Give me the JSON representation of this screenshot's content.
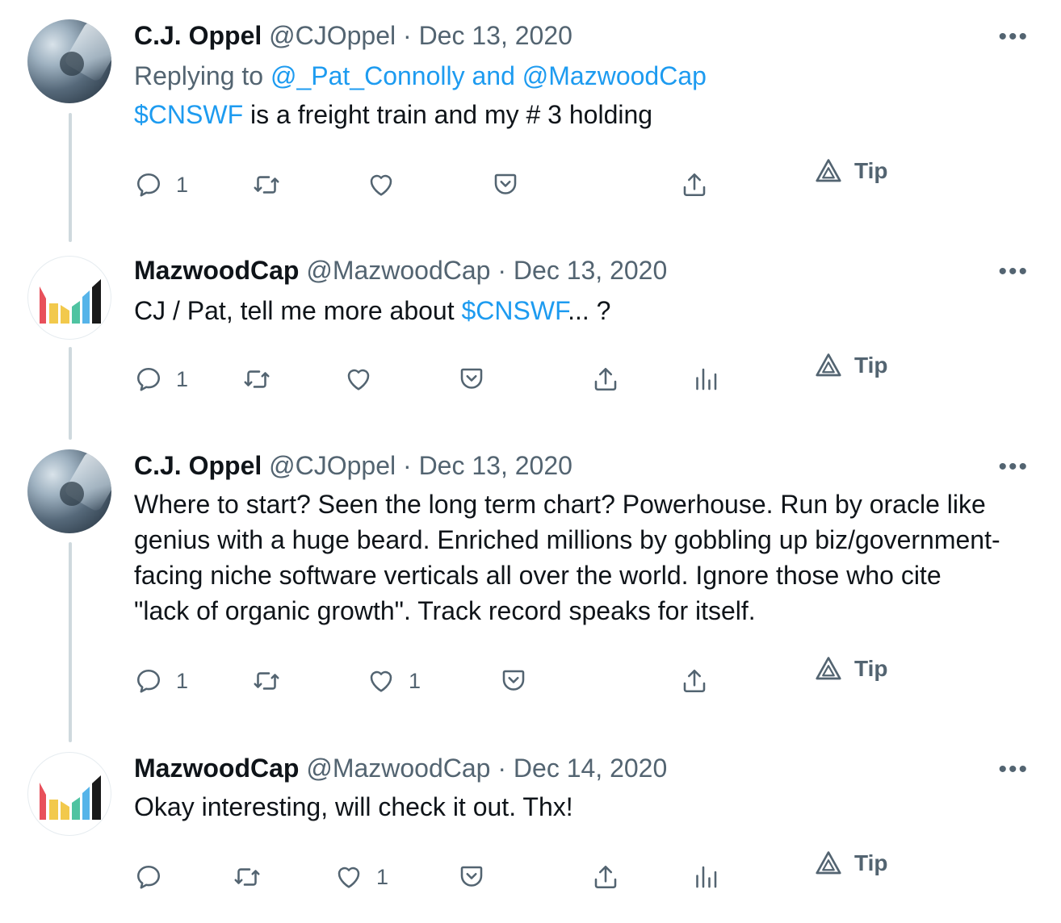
{
  "tweets": [
    {
      "name": "C.J. Oppel",
      "handle": "@CJOppel",
      "sep": "·",
      "date": "Dec 13, 2020",
      "replying_prefix": "Replying to",
      "replying_to": "@_Pat_Connolly and @MazwoodCap",
      "text_link": "$CNSWF",
      "text_rest": " is a freight train and my # 3 holding",
      "reply_count": "1",
      "like_count": "",
      "tip_label": "Tip",
      "more_label": "•••"
    },
    {
      "name": "MazwoodCap",
      "handle": "@MazwoodCap",
      "sep": "·",
      "date": "Dec 13, 2020",
      "text_before": "CJ / Pat, tell me more about ",
      "text_link": "$CNSWF",
      "text_after": "... ?",
      "reply_count": "1",
      "like_count": "",
      "tip_label": "Tip",
      "more_label": "•••"
    },
    {
      "name": "C.J. Oppel",
      "handle": "@CJOppel",
      "sep": "·",
      "date": "Dec 13, 2020",
      "lines": [
        "Where to start? Seen the long term chart? Powerhouse. Run by oracle like",
        "genius with a huge beard. Enriched millions by gobbling up biz/government-",
        "facing niche software verticals all over the world. Ignore those who cite",
        "\"lack of organic growth\". Track record speaks for itself."
      ],
      "reply_count": "1",
      "like_count": "1",
      "tip_label": "Tip",
      "more_label": "•••"
    },
    {
      "name": "MazwoodCap",
      "handle": "@MazwoodCap",
      "sep": "·",
      "date": "Dec 14, 2020",
      "text": "Okay interesting, will check it out. Thx!",
      "reply_count": "",
      "like_count": "1",
      "tip_label": "Tip",
      "more_label": "•••"
    }
  ],
  "colors": {
    "link": "#1d9bf0",
    "muted": "#536471",
    "text": "#0f1419",
    "thread_line": "#cfd9de"
  },
  "icons": [
    "reply-icon",
    "retweet-icon",
    "like-icon",
    "bookmark-icon",
    "share-icon",
    "analytics-icon",
    "tip-icon",
    "more-icon"
  ]
}
